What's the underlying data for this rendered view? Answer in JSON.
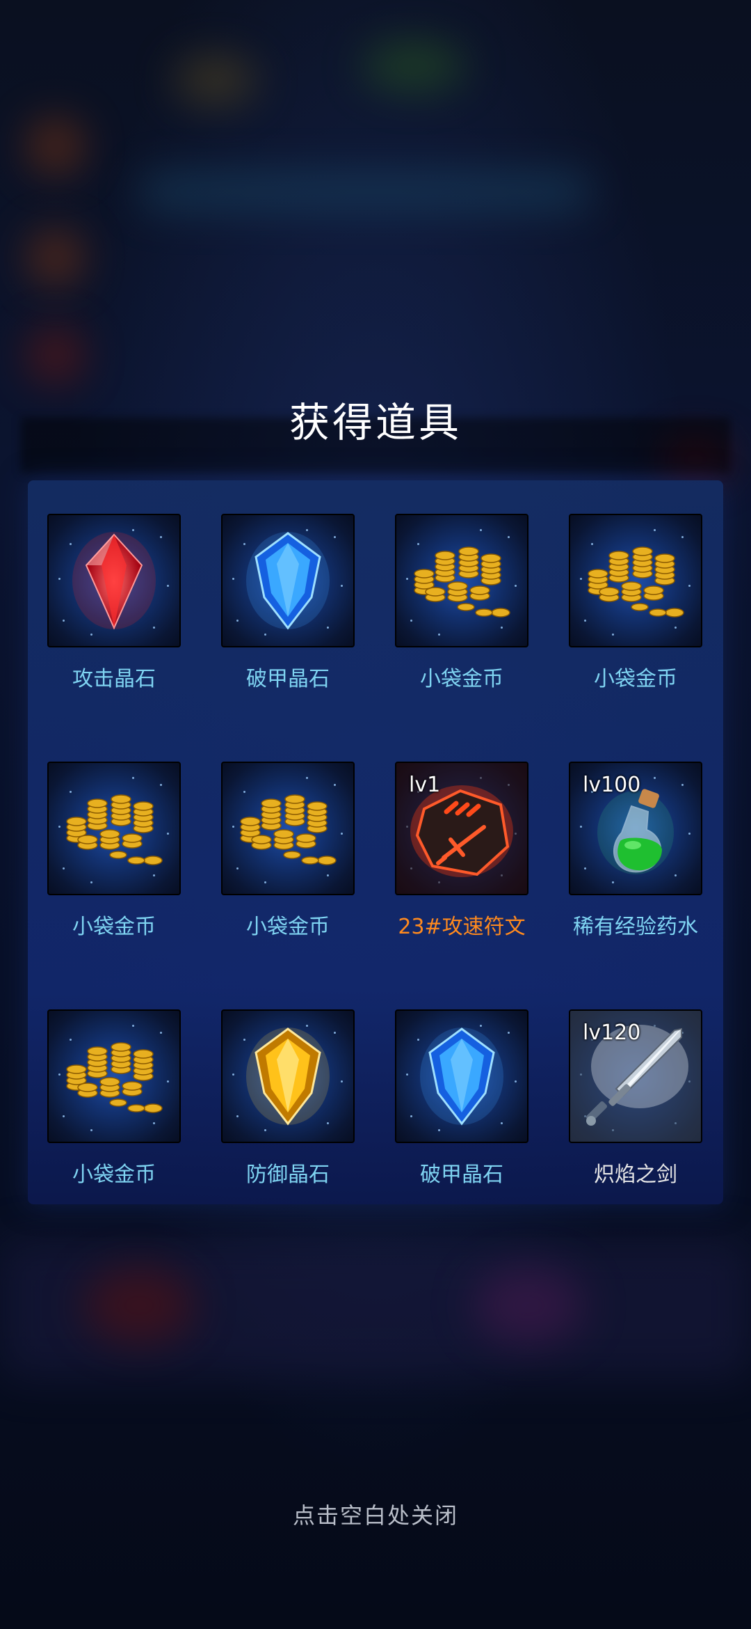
{
  "dialog": {
    "title": "获得道具",
    "close_hint": "点击空白处关闭"
  },
  "items": [
    {
      "name": "攻击晶石",
      "icon": "red-crystal-icon",
      "level": "",
      "color": "#7fd4f2"
    },
    {
      "name": "破甲晶石",
      "icon": "blue-crystal-icon",
      "level": "",
      "color": "#7fd4f2"
    },
    {
      "name": "小袋金币",
      "icon": "gold-coins-icon",
      "level": "",
      "color": "#7fd4f2"
    },
    {
      "name": "小袋金币",
      "icon": "gold-coins-icon",
      "level": "",
      "color": "#7fd4f2"
    },
    {
      "name": "小袋金币",
      "icon": "gold-coins-icon",
      "level": "",
      "color": "#7fd4f2"
    },
    {
      "name": "小袋金币",
      "icon": "gold-coins-icon",
      "level": "",
      "color": "#7fd4f2"
    },
    {
      "name": "23#攻速符文",
      "icon": "attack-speed-rune-icon",
      "level": "lv1",
      "color": "#ff8a1e"
    },
    {
      "name": "稀有经验药水",
      "icon": "green-potion-icon",
      "level": "lv100",
      "color": "#7fd4f2"
    },
    {
      "name": "小袋金币",
      "icon": "gold-coins-icon",
      "level": "",
      "color": "#7fd4f2"
    },
    {
      "name": "防御晶石",
      "icon": "yellow-crystal-icon",
      "level": "",
      "color": "#7fd4f2"
    },
    {
      "name": "破甲晶石",
      "icon": "blue-crystal-icon",
      "level": "",
      "color": "#7fd4f2"
    },
    {
      "name": "炽焰之剑",
      "icon": "sword-icon",
      "level": "lv120",
      "color": "#e8e8e8"
    }
  ]
}
